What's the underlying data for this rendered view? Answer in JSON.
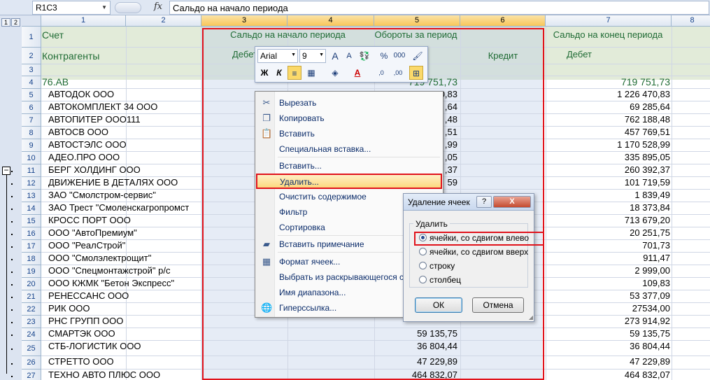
{
  "formula_bar": {
    "name_box": "R1C3",
    "fx_label": "fx",
    "formula": "Сальдо на начало периода"
  },
  "outline": {
    "levels": [
      "1",
      "2"
    ],
    "collapse": "−"
  },
  "columns": [
    {
      "label": "1",
      "selected": false
    },
    {
      "label": "2",
      "selected": false
    },
    {
      "label": "3",
      "selected": true
    },
    {
      "label": "4",
      "selected": true
    },
    {
      "label": "5",
      "selected": true
    },
    {
      "label": "6",
      "selected": true
    },
    {
      "label": "7",
      "selected": false
    },
    {
      "label": "8",
      "selected": false
    }
  ],
  "rows": [
    {
      "num": "1",
      "a": "Счет",
      "c": "Сальдо на начало периода",
      "e": "Обороты за период",
      "g": "Сальдо на конец периода"
    },
    {
      "num": "2",
      "a": "Контрагенты",
      "c": "Дебет",
      "e": "",
      "f": "Кредит",
      "g": "Дебет"
    },
    {
      "num": "3"
    },
    {
      "num": "4",
      "a": "76.АВ",
      "e": "719 751,73",
      "g": "719 751,73"
    },
    {
      "num": "5",
      "a": "АВТОДОК ООО",
      "e": "1 226 470,83",
      "g": "1 226 470,83"
    },
    {
      "num": "6",
      "a": "АВТОКОМПЛЕКТ 34 ООО",
      "e": ",64",
      "g": "69 285,64"
    },
    {
      "num": "7",
      "a": "АВТОПИТЕР ООО111",
      "e": ",48",
      "g": "762 188,48"
    },
    {
      "num": "8",
      "a": "АВТОСВ ООО",
      "e": ",51",
      "g": "457 769,51"
    },
    {
      "num": "9",
      "a": "АВТОСТЭЛС ООО",
      "e": ",99",
      "g": "1 170 528,99"
    },
    {
      "num": "10",
      "a": "АДЕО.ПРО ООО",
      "e": ",05",
      "g": "335 895,05"
    },
    {
      "num": "11",
      "a": "БЕРГ ХОЛДИНГ ООО",
      "e": ",37",
      "g": "260 392,37"
    },
    {
      "num": "12",
      "a": "ДВИЖЕНИЕ В ДЕТАЛЯХ ООО",
      "e": "59",
      "g": "101 719,59"
    },
    {
      "num": "13",
      "a": "ЗАО \"Смолстром-сервис\"",
      "e": "",
      "g": "1 839,49"
    },
    {
      "num": "14",
      "a": "ЗАО Трест \"Смоленскагропромст",
      "e": "",
      "g": "18 373,84"
    },
    {
      "num": "15",
      "a": "КРОСС ПОРТ ООО",
      "e": "",
      "g": "713 679,20"
    },
    {
      "num": "16",
      "a": "ООО \"АвтоПремиум\"",
      "e": "",
      "g": "20 251,75"
    },
    {
      "num": "17",
      "a": "ООО \"РеалСтрой\"",
      "e": "",
      "g": "701,73"
    },
    {
      "num": "18",
      "a": "ООО \"Смолэлектрощит\"",
      "e": "",
      "g": "911,47"
    },
    {
      "num": "19",
      "a": "ООО \"Спецмонтажстрой\" р/с",
      "e": "",
      "g": "2 999,00"
    },
    {
      "num": "20",
      "a": "ООО КЖМК \"Бетон Экспресс\"",
      "e": "",
      "g": "109,83"
    },
    {
      "num": "21",
      "a": "РЕНЕССАНС ООО",
      "e": "",
      "g": "53 377,09"
    },
    {
      "num": "22",
      "a": "РИК ООО",
      "e": "",
      "g": "27534,00"
    },
    {
      "num": "23",
      "a": "РНС ГРУПП ООО",
      "e": "",
      "g": "273 914,92"
    },
    {
      "num": "24",
      "a": "СМАРТЭК ООО",
      "e": "59 135,75",
      "g": "59 135,75"
    },
    {
      "num": "25",
      "a": "СТБ-ЛОГИСТИК ООО",
      "e": "36 804,44",
      "g": "36 804,44"
    },
    {
      "num": "26",
      "a": "СТРЕТТО ООО",
      "e": "47 229,89",
      "g": "47 229,89"
    },
    {
      "num": "27",
      "a": "ТЕХНО АВТО ПЛЮС ООО",
      "e": "464 832,07",
      "g": "464 832,07"
    }
  ],
  "mini_toolbar": {
    "font_name": "Arial",
    "font_size": "9",
    "grow_font": "A",
    "shrink_font": "A",
    "percent": "%",
    "thousands": "000",
    "bold": "Ж",
    "italic": "К",
    "font_color": "A",
    "inc_decimal": ",0",
    "dec_decimal": ",00"
  },
  "context_menu": {
    "items": [
      {
        "label": "Вырезать",
        "icon": "✂"
      },
      {
        "label": "Копировать",
        "icon": "❐"
      },
      {
        "label": "Вставить",
        "icon": "📋"
      },
      {
        "label": "Специальная вставка...",
        "icon": ""
      },
      {
        "label": "Вставить...",
        "icon": ""
      },
      {
        "label": "Удалить...",
        "icon": "",
        "highlight": true
      },
      {
        "label": "Очистить содержимое",
        "icon": ""
      },
      {
        "label": "Фильтр",
        "icon": ""
      },
      {
        "label": "Сортировка",
        "icon": ""
      },
      {
        "label": "Вставить примечание",
        "icon": "▰"
      },
      {
        "label": "Формат ячеек...",
        "icon": "▦"
      },
      {
        "label": "Выбрать из раскрывающегося сп",
        "icon": ""
      },
      {
        "label": "Имя диапазона...",
        "icon": ""
      },
      {
        "label": "Гиперссылка...",
        "icon": "🌐"
      }
    ]
  },
  "dialog": {
    "title": "Удаление ячеек",
    "help": "?",
    "close": "X",
    "group_label": "Удалить",
    "options": [
      {
        "label": "ячейки, со сдвигом влево",
        "checked": true
      },
      {
        "label": "ячейки, со сдвигом вверх",
        "checked": false
      },
      {
        "label": "строку",
        "checked": false
      },
      {
        "label": "столбец",
        "checked": false
      }
    ],
    "ok": "ОК",
    "cancel": "Отмена"
  },
  "colors": {
    "selection_border": "#e0121b",
    "header_band": "#e2ebd9",
    "total_row_text": "#1f6b34"
  }
}
